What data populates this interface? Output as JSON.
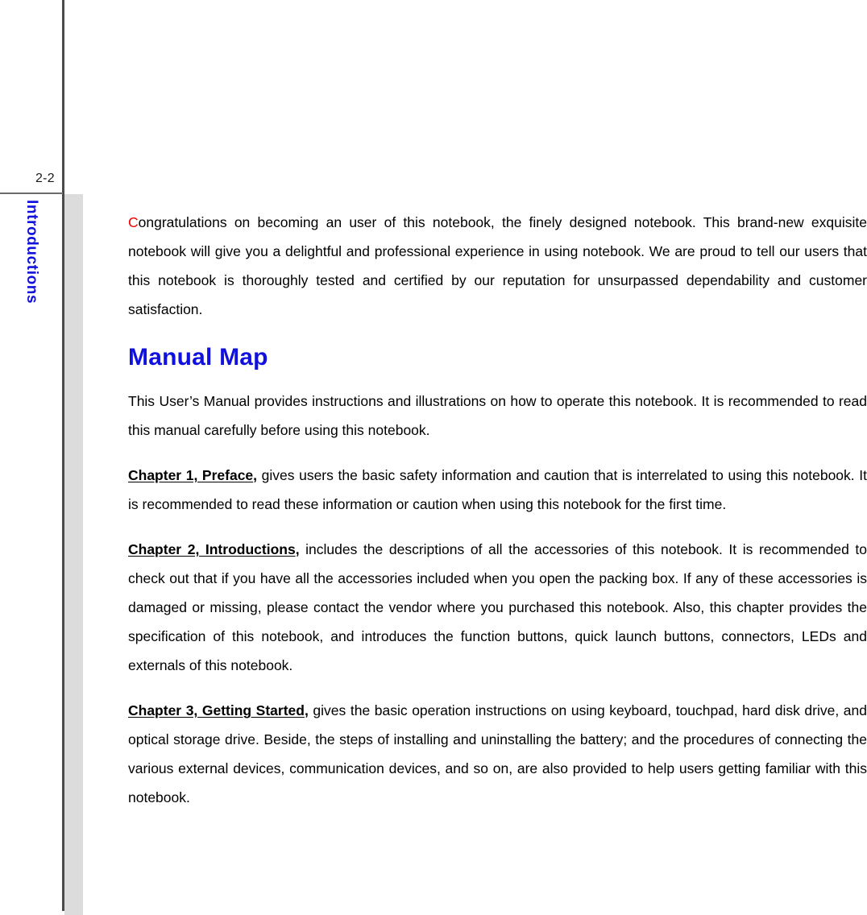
{
  "page": {
    "number": "2-2",
    "chapter_tab": "Introductions",
    "accent_blue": "#1111dd",
    "dropcap_red": "#ee0000",
    "band_gray": "#dcdcdc",
    "rule_gray": "#4a4a4a"
  },
  "content": {
    "intro_paragraph": {
      "dropcap": "C",
      "rest": "ongratulations on becoming an user of this notebook, the finely designed notebook.  This brand-new exquisite notebook will give you a delightful and professional experience in using notebook.  We are proud to tell our users that this notebook is thoroughly tested and certified by our reputation for unsurpassed dependability and customer satisfaction."
    },
    "manual_map_heading": "Manual Map",
    "manual_map_paragraph": "This User’s Manual provides instructions and illustrations on how to operate this notebook.  It is recommended to read this manual carefully before using this notebook.",
    "chapters": [
      {
        "ref": "Chapter 1, Preface",
        "ref_comma": ",",
        "text": " gives users the basic safety information and caution that is interrelated to using this notebook.  It is recommended to read these information or caution when using this notebook for the first time."
      },
      {
        "ref": "Chapter 2, Introductions",
        "ref_comma": ",",
        "text": " includes the descriptions of all the accessories of this notebook.  It is recommended to check out that if you have all the accessories included when you open the packing box.  If any of these accessories is damaged or missing, please contact the vendor where you purchased this notebook.  Also, this chapter provides the specification of this notebook, and introduces the function buttons, quick launch buttons, connectors, LEDs and externals of this notebook."
      },
      {
        "ref": "Chapter 3, Getting Started",
        "ref_comma": ",",
        "text": " gives the basic operation instructions on using keyboard, touchpad, hard disk drive, and optical storage drive.  Beside, the steps of installing and uninstalling the battery; and the procedures of connecting the various external devices, communication devices, and so on, are also provided to help users getting familiar with this notebook."
      }
    ]
  }
}
